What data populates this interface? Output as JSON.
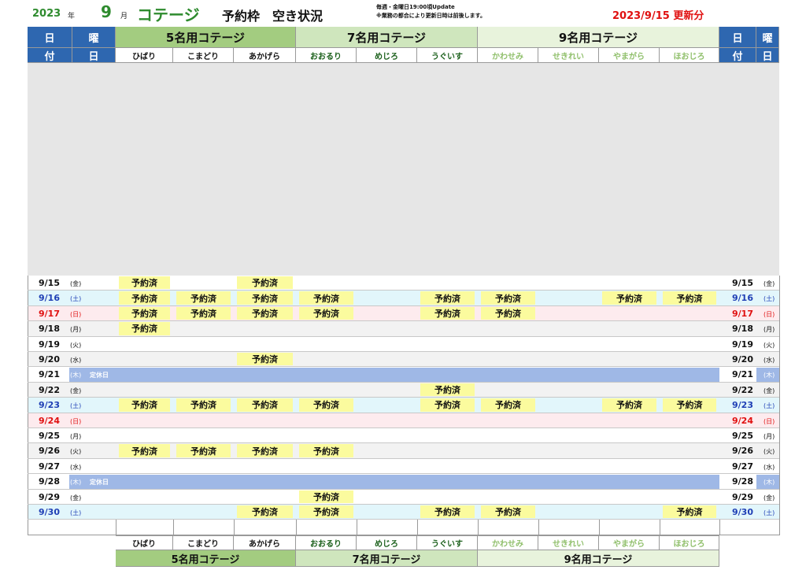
{
  "header": {
    "year": "2023",
    "year_unit": "年",
    "month": "9",
    "month_unit": "月",
    "cottage_title": "コテージ",
    "slots_title": "予約枠　空き状況",
    "note1": "毎週・金曜日19:00頃Update",
    "note2": "※業務の都合により更新日時は前後します。",
    "updated": "2023/9/15 更新分"
  },
  "columns": {
    "day_label": "日",
    "date_label": "付",
    "weekday_label1": "曜",
    "weekday_label2": "日",
    "groups": [
      "5名用コテージ",
      "7名用コテージ",
      "9名用コテージ"
    ],
    "cabins": [
      "ひばり",
      "こまどり",
      "あかげら",
      "おおるり",
      "めじろ",
      "うぐいす",
      "かわせみ",
      "せきれい",
      "やまがら",
      "ほおじろ"
    ]
  },
  "booked_label": "予約済",
  "holiday_label": "定休日",
  "rows": [
    {
      "date": "9/15",
      "wd": "(金)",
      "type": "weekday",
      "booked": [
        0,
        2
      ]
    },
    {
      "date": "9/16",
      "wd": "(土)",
      "type": "sat",
      "booked": [
        0,
        1,
        2,
        3,
        5,
        6,
        8,
        9
      ]
    },
    {
      "date": "9/17",
      "wd": "(日)",
      "type": "sun",
      "booked": [
        0,
        1,
        2,
        3,
        5,
        6
      ]
    },
    {
      "date": "9/18",
      "wd": "(月)",
      "type": "weekday",
      "booked": [
        0
      ]
    },
    {
      "date": "9/19",
      "wd": "(火)",
      "type": "weekday",
      "booked": []
    },
    {
      "date": "9/20",
      "wd": "(水)",
      "type": "weekday",
      "booked": [
        2
      ]
    },
    {
      "date": "9/21",
      "wd": "(木)",
      "type": "closed",
      "booked": []
    },
    {
      "date": "9/22",
      "wd": "(金)",
      "type": "weekday",
      "booked": [
        5
      ]
    },
    {
      "date": "9/23",
      "wd": "(土)",
      "type": "sat",
      "booked": [
        0,
        1,
        2,
        3,
        5,
        6,
        8,
        9
      ]
    },
    {
      "date": "9/24",
      "wd": "(日)",
      "type": "sun",
      "booked": []
    },
    {
      "date": "9/25",
      "wd": "(月)",
      "type": "weekday",
      "booked": []
    },
    {
      "date": "9/26",
      "wd": "(火)",
      "type": "weekday",
      "booked": [
        0,
        1,
        2,
        3
      ]
    },
    {
      "date": "9/27",
      "wd": "(水)",
      "type": "weekday",
      "booked": []
    },
    {
      "date": "9/28",
      "wd": "(木)",
      "type": "closed",
      "booked": []
    },
    {
      "date": "9/29",
      "wd": "(金)",
      "type": "weekday",
      "booked": [
        3
      ]
    },
    {
      "date": "9/30",
      "wd": "(土)",
      "type": "sat",
      "booked": [
        2,
        3,
        5,
        6,
        9
      ]
    }
  ],
  "colors": {
    "group5": "#a3cc80",
    "group7": "#cfe6bd",
    "group9": "#e8f3dc",
    "cabin5_text": "#111111",
    "cabin7_text": "#1a5f1a",
    "cabin9_text": "#8fbf6a",
    "sat_text": "#1f3fb5",
    "sun_text": "#e01010",
    "sat_bg": "#e2f6fb",
    "sun_bg": "#fdebee",
    "booked_bg": "#fbfb9e",
    "closed_bar": "#9fb8e6"
  }
}
